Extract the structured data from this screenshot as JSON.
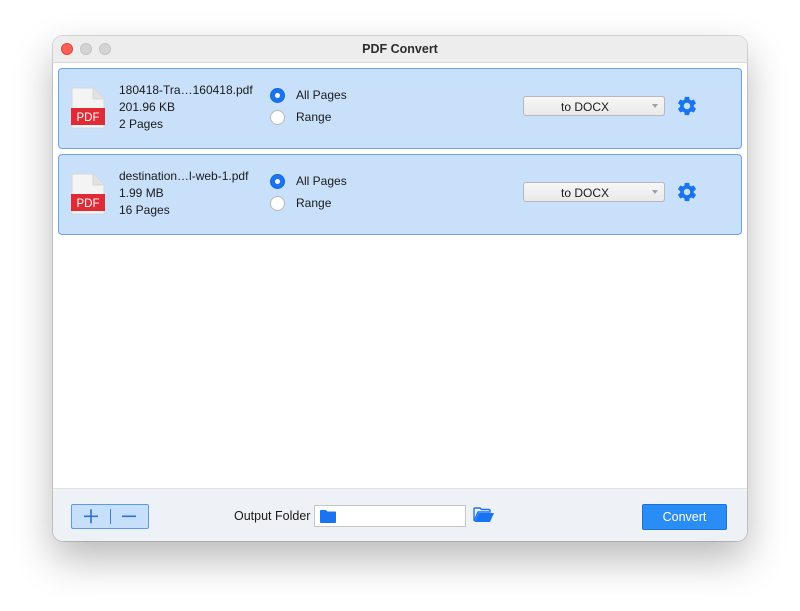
{
  "window": {
    "title": "PDF Convert"
  },
  "files": [
    {
      "name": "180418-Tra…160418.pdf",
      "size": "201.96 KB",
      "pages": "2 Pages",
      "icon_label": "PDF",
      "page_options": {
        "all_pages": "All Pages",
        "range": "Range",
        "selected": "All Pages"
      },
      "format": "to DOCX"
    },
    {
      "name": "destination…l-web-1.pdf",
      "size": "1.99 MB",
      "pages": "16 Pages",
      "icon_label": "PDF",
      "page_options": {
        "all_pages": "All Pages",
        "range": "Range",
        "selected": "All Pages"
      },
      "format": "to DOCX"
    }
  ],
  "bottom": {
    "add_icon": "plus-icon",
    "remove_icon": "minus-icon",
    "output_folder_label": "Output Folder",
    "output_folder_value": "",
    "convert_label": "Convert"
  },
  "colors": {
    "accent": "#1a74f0",
    "row_fill": "#c8e0fa",
    "row_border": "#6ea4e8",
    "pdf_red": "#e02a35",
    "button": "#2a8cf5"
  }
}
